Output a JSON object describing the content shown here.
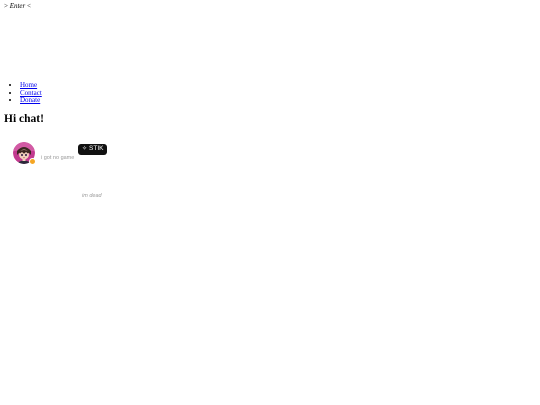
{
  "enter": {
    "left_bracket": "> ",
    "label": "Enter",
    "right_bracket": " <"
  },
  "nav": {
    "items": [
      {
        "label": "Home"
      },
      {
        "label": "Contact"
      },
      {
        "label": "Donate"
      }
    ]
  },
  "greeting": "Hi chat!",
  "profile": {
    "avatar_icon": "anime-character-avatar",
    "status_color": "#f5a623",
    "tag_icon": "sparkle-icon",
    "tag_symbol": "✧",
    "tag_label": "STIK",
    "status_text": "i got no game"
  },
  "footer_note": "im dead"
}
